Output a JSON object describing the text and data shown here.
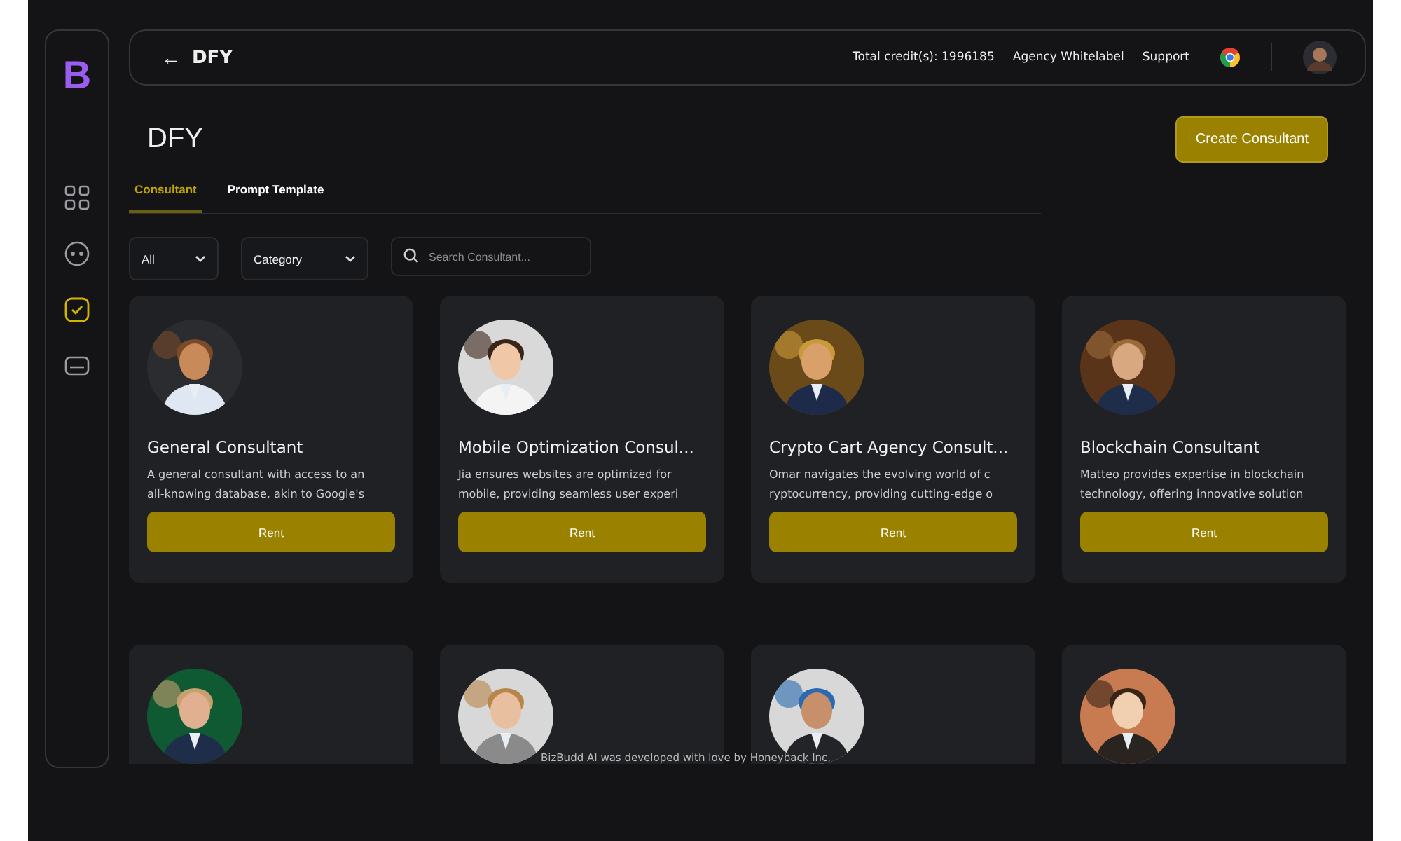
{
  "sidebar": {
    "logo": "B",
    "items": [
      {
        "selected": false
      },
      {
        "selected": false
      },
      {
        "selected": true
      },
      {
        "selected": false
      }
    ]
  },
  "topbar": {
    "back": "←",
    "title": "DFY",
    "links": [
      "Total credit(s): 1996185",
      "Agency Whitelabel",
      "Support"
    ]
  },
  "page": {
    "title": "DFY",
    "create_button": "Create Consultant"
  },
  "tabs": [
    {
      "label": "Consultant",
      "selected": true
    },
    {
      "label": "Prompt Template",
      "selected": false
    }
  ],
  "filters": {
    "dropdowns": [
      "All",
      "Category"
    ],
    "search": {
      "placeholder": "Search Consultant..."
    }
  },
  "cards": [
    {
      "avatar": {
        "kind": "picture"
      },
      "title": "General Consultant",
      "lines": [
        "A general consultant with access to an",
        "all-knowing database, akin to Google's"
      ],
      "button": "Rent"
    },
    {
      "avatar": {
        "kind": "picture"
      },
      "title": "Mobile Optimization Consul...",
      "lines": [
        "Jia ensures websites are optimized for",
        "mobile, providing seamless user experi"
      ],
      "button": "Rent"
    },
    {
      "avatar": {
        "kind": "picture"
      },
      "title": "Crypto Cart Agency Consult...",
      "lines": [
        "Omar navigates the evolving world of c",
        "ryptocurrency, providing cutting-edge o"
      ],
      "button": "Rent"
    },
    {
      "avatar": {
        "kind": "picture"
      },
      "title": "Blockchain Consultant",
      "lines": [
        "Matteo provides expertise in blockchain",
        "technology, offering innovative solution"
      ],
      "button": "Rent"
    },
    {
      "avatar": {
        "kind": "picture"
      }
    },
    {
      "avatar": {
        "kind": "picture"
      }
    },
    {
      "avatar": {
        "kind": "picture"
      }
    },
    {
      "avatar": {
        "kind": "picture"
      }
    }
  ],
  "footer": "BizBudd AI was developed with love by Honeyback Inc."
}
